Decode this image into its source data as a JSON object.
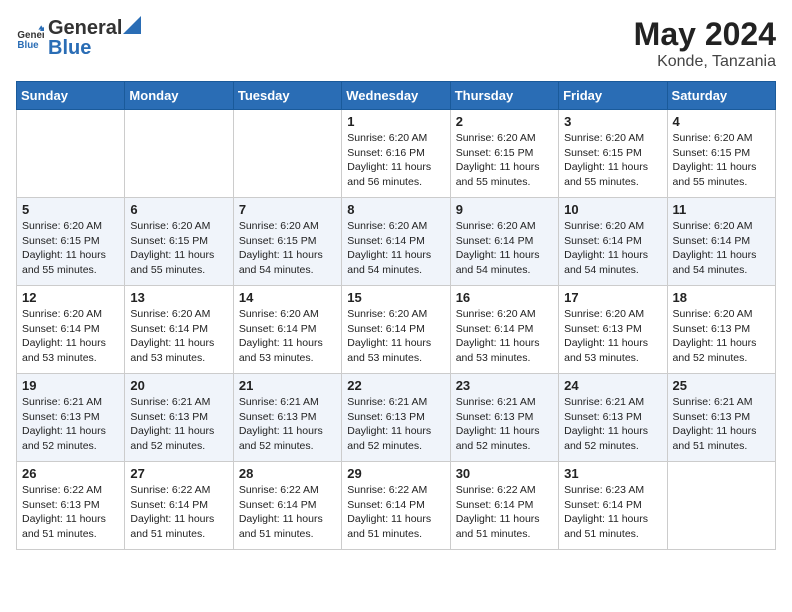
{
  "header": {
    "logo_general": "General",
    "logo_blue": "Blue",
    "title": "May 2024",
    "location": "Konde, Tanzania"
  },
  "days_of_week": [
    "Sunday",
    "Monday",
    "Tuesday",
    "Wednesday",
    "Thursday",
    "Friday",
    "Saturday"
  ],
  "weeks": [
    [
      {
        "day": "",
        "info": ""
      },
      {
        "day": "",
        "info": ""
      },
      {
        "day": "",
        "info": ""
      },
      {
        "day": "1",
        "info": "Sunrise: 6:20 AM\nSunset: 6:16 PM\nDaylight: 11 hours and 56 minutes."
      },
      {
        "day": "2",
        "info": "Sunrise: 6:20 AM\nSunset: 6:15 PM\nDaylight: 11 hours and 55 minutes."
      },
      {
        "day": "3",
        "info": "Sunrise: 6:20 AM\nSunset: 6:15 PM\nDaylight: 11 hours and 55 minutes."
      },
      {
        "day": "4",
        "info": "Sunrise: 6:20 AM\nSunset: 6:15 PM\nDaylight: 11 hours and 55 minutes."
      }
    ],
    [
      {
        "day": "5",
        "info": "Sunrise: 6:20 AM\nSunset: 6:15 PM\nDaylight: 11 hours and 55 minutes."
      },
      {
        "day": "6",
        "info": "Sunrise: 6:20 AM\nSunset: 6:15 PM\nDaylight: 11 hours and 55 minutes."
      },
      {
        "day": "7",
        "info": "Sunrise: 6:20 AM\nSunset: 6:15 PM\nDaylight: 11 hours and 54 minutes."
      },
      {
        "day": "8",
        "info": "Sunrise: 6:20 AM\nSunset: 6:14 PM\nDaylight: 11 hours and 54 minutes."
      },
      {
        "day": "9",
        "info": "Sunrise: 6:20 AM\nSunset: 6:14 PM\nDaylight: 11 hours and 54 minutes."
      },
      {
        "day": "10",
        "info": "Sunrise: 6:20 AM\nSunset: 6:14 PM\nDaylight: 11 hours and 54 minutes."
      },
      {
        "day": "11",
        "info": "Sunrise: 6:20 AM\nSunset: 6:14 PM\nDaylight: 11 hours and 54 minutes."
      }
    ],
    [
      {
        "day": "12",
        "info": "Sunrise: 6:20 AM\nSunset: 6:14 PM\nDaylight: 11 hours and 53 minutes."
      },
      {
        "day": "13",
        "info": "Sunrise: 6:20 AM\nSunset: 6:14 PM\nDaylight: 11 hours and 53 minutes."
      },
      {
        "day": "14",
        "info": "Sunrise: 6:20 AM\nSunset: 6:14 PM\nDaylight: 11 hours and 53 minutes."
      },
      {
        "day": "15",
        "info": "Sunrise: 6:20 AM\nSunset: 6:14 PM\nDaylight: 11 hours and 53 minutes."
      },
      {
        "day": "16",
        "info": "Sunrise: 6:20 AM\nSunset: 6:14 PM\nDaylight: 11 hours and 53 minutes."
      },
      {
        "day": "17",
        "info": "Sunrise: 6:20 AM\nSunset: 6:13 PM\nDaylight: 11 hours and 53 minutes."
      },
      {
        "day": "18",
        "info": "Sunrise: 6:20 AM\nSunset: 6:13 PM\nDaylight: 11 hours and 52 minutes."
      }
    ],
    [
      {
        "day": "19",
        "info": "Sunrise: 6:21 AM\nSunset: 6:13 PM\nDaylight: 11 hours and 52 minutes."
      },
      {
        "day": "20",
        "info": "Sunrise: 6:21 AM\nSunset: 6:13 PM\nDaylight: 11 hours and 52 minutes."
      },
      {
        "day": "21",
        "info": "Sunrise: 6:21 AM\nSunset: 6:13 PM\nDaylight: 11 hours and 52 minutes."
      },
      {
        "day": "22",
        "info": "Sunrise: 6:21 AM\nSunset: 6:13 PM\nDaylight: 11 hours and 52 minutes."
      },
      {
        "day": "23",
        "info": "Sunrise: 6:21 AM\nSunset: 6:13 PM\nDaylight: 11 hours and 52 minutes."
      },
      {
        "day": "24",
        "info": "Sunrise: 6:21 AM\nSunset: 6:13 PM\nDaylight: 11 hours and 52 minutes."
      },
      {
        "day": "25",
        "info": "Sunrise: 6:21 AM\nSunset: 6:13 PM\nDaylight: 11 hours and 51 minutes."
      }
    ],
    [
      {
        "day": "26",
        "info": "Sunrise: 6:22 AM\nSunset: 6:13 PM\nDaylight: 11 hours and 51 minutes."
      },
      {
        "day": "27",
        "info": "Sunrise: 6:22 AM\nSunset: 6:14 PM\nDaylight: 11 hours and 51 minutes."
      },
      {
        "day": "28",
        "info": "Sunrise: 6:22 AM\nSunset: 6:14 PM\nDaylight: 11 hours and 51 minutes."
      },
      {
        "day": "29",
        "info": "Sunrise: 6:22 AM\nSunset: 6:14 PM\nDaylight: 11 hours and 51 minutes."
      },
      {
        "day": "30",
        "info": "Sunrise: 6:22 AM\nSunset: 6:14 PM\nDaylight: 11 hours and 51 minutes."
      },
      {
        "day": "31",
        "info": "Sunrise: 6:23 AM\nSunset: 6:14 PM\nDaylight: 11 hours and 51 minutes."
      },
      {
        "day": "",
        "info": ""
      }
    ]
  ]
}
